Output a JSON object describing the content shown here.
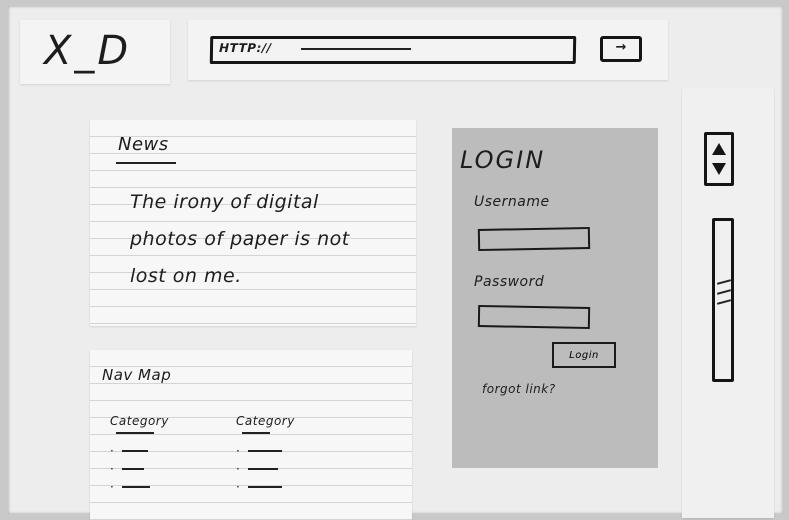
{
  "header": {
    "logo": "X_D",
    "url_prefix": "HTTP://",
    "go_button_glyph": "→"
  },
  "news": {
    "heading": "News",
    "body": "The irony of digital photos of paper is not lost on me."
  },
  "nav_map": {
    "heading": "Nav Map",
    "categories": [
      {
        "label": "Category",
        "items": 3
      },
      {
        "label": "Category",
        "items": 3
      }
    ]
  },
  "login": {
    "title": "LOGIN",
    "username_label": "Username",
    "username_value": "",
    "password_label": "Password",
    "password_value": "",
    "button_label": "Login",
    "forgot_link": "forgot link?"
  },
  "scrollbar": {
    "up_icon": "triangle-up",
    "down_icon": "triangle-down",
    "thumb_position": 0.45
  },
  "colors": {
    "paper": "#f6f6f6",
    "login_card": "#bcbcbc",
    "ink": "#1d1d1d",
    "board": "#c9c9c9"
  }
}
